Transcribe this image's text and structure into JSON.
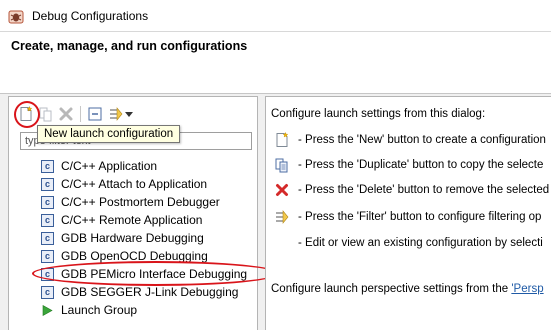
{
  "window": {
    "title": "Debug Configurations",
    "icon": "debug-configurations-icon"
  },
  "header": {
    "title": "Create, manage, and run configurations"
  },
  "toolbar": {
    "buttons": [
      "new-launch-configuration-icon",
      "duplicate-icon",
      "delete-icon",
      "collapse-all-icon",
      "filter-icon",
      "view-menu-chevron-icon"
    ],
    "tooltip": "New launch configuration"
  },
  "filter": {
    "value": "type filter text"
  },
  "tree": {
    "items": [
      {
        "label": "C/C++ Application",
        "icon": "c-icon"
      },
      {
        "label": "C/C++ Attach to Application",
        "icon": "c-icon"
      },
      {
        "label": "C/C++ Postmortem Debugger",
        "icon": "c-icon"
      },
      {
        "label": "C/C++ Remote Application",
        "icon": "c-icon"
      },
      {
        "label": "GDB Hardware Debugging",
        "icon": "c-icon"
      },
      {
        "label": "GDB OpenOCD Debugging",
        "icon": "c-icon"
      },
      {
        "label": "GDB PEMicro Interface Debugging",
        "icon": "c-icon"
      },
      {
        "label": "GDB SEGGER J-Link Debugging",
        "icon": "c-icon"
      },
      {
        "label": "Launch Group",
        "icon": "launch-group-icon"
      }
    ]
  },
  "right_pane": {
    "intro": "Configure launch settings from this dialog:",
    "rows": [
      {
        "icon": "new-icon",
        "text": "- Press the 'New' button to create a configuration"
      },
      {
        "icon": "duplicate-icon",
        "text": "- Press the 'Duplicate' button to copy the selecte"
      },
      {
        "icon": "delete-icon",
        "text": "- Press the 'Delete' button to remove the selected"
      },
      {
        "icon": "filter-icon",
        "text": "- Press the 'Filter' button to configure filtering op"
      },
      {
        "icon": "",
        "text": "- Edit or view an existing configuration by selecti"
      }
    ],
    "perspective_text": "Configure launch perspective settings from the ",
    "perspective_link": "'Persp"
  },
  "colors": {
    "highlight": "#d9141a",
    "tooltip_bg": "#ffffe1",
    "link": "#1f5aa6"
  }
}
